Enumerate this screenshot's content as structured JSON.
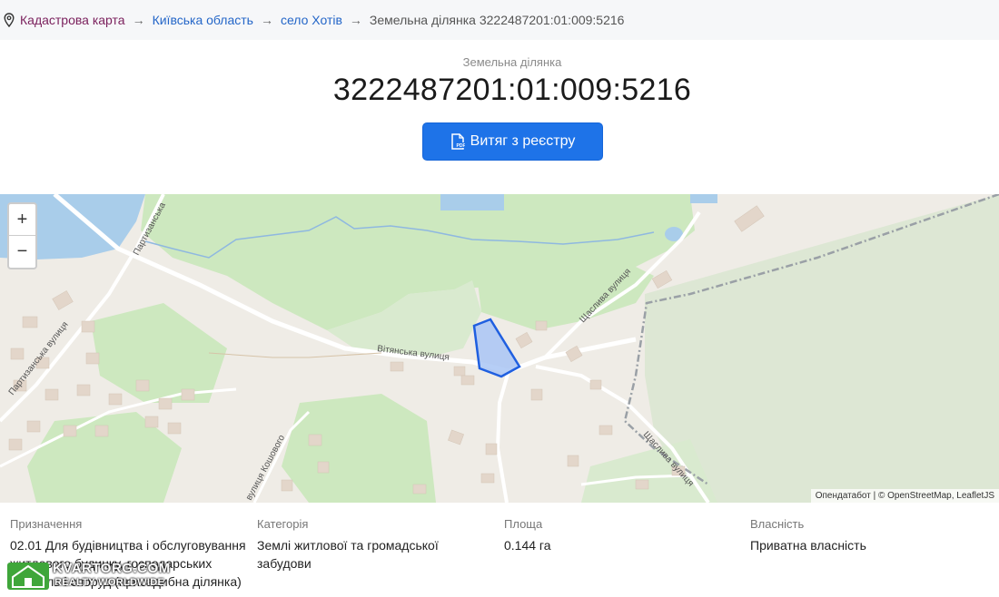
{
  "breadcrumb": {
    "items": [
      {
        "label": "Кадастрова карта"
      },
      {
        "label": "Київська область"
      },
      {
        "label": "село Хотів"
      }
    ],
    "separator": "→",
    "current": "Земельна ділянка 3222487201:01:009:5216"
  },
  "header": {
    "subtitle": "Земельна ділянка",
    "title": "3222487201:01:009:5216",
    "extract_button_label": "Витяг з реєстру",
    "extract_button_icon": "pdf-file-icon"
  },
  "map": {
    "zoom_in_label": "+",
    "zoom_out_label": "−",
    "attribution": "Опендатабот | © OpenStreetMap, LeafletJS",
    "street_labels": {
      "partyzanska_top": "Партизанська",
      "partyzanska_left": "Партизанська вулиця",
      "vitianska": "Вітянська вулиця",
      "shchaslyva_top": "Щаслива вулиця",
      "shchaslyva_bottom": "Щаслива вулиця",
      "koshovoho": "вулиця Кошового"
    },
    "colors": {
      "background": "#efece6",
      "forest": "#cde8bf",
      "water": "#a9cdea",
      "parcel_fill": "#a9c6f4",
      "parcel_stroke": "#1f5fe0"
    }
  },
  "info": {
    "purpose": {
      "label": "Призначення",
      "lines": [
        "02.01 Для будівництва і обслуговування",
        "житлового будинку, господарських",
        "будівель і споруд (присадибна ділянка)"
      ]
    },
    "category": {
      "label": "Категорія",
      "value": "Землі житлової та громадської забудови"
    },
    "area": {
      "label": "Площа",
      "value": "0.144 га"
    },
    "ownership": {
      "label": "Власність",
      "value": "Приватна власність"
    }
  },
  "watermark": {
    "line1": "KVARTORG.COM",
    "line2": "REALTY WORLDWIDE"
  }
}
